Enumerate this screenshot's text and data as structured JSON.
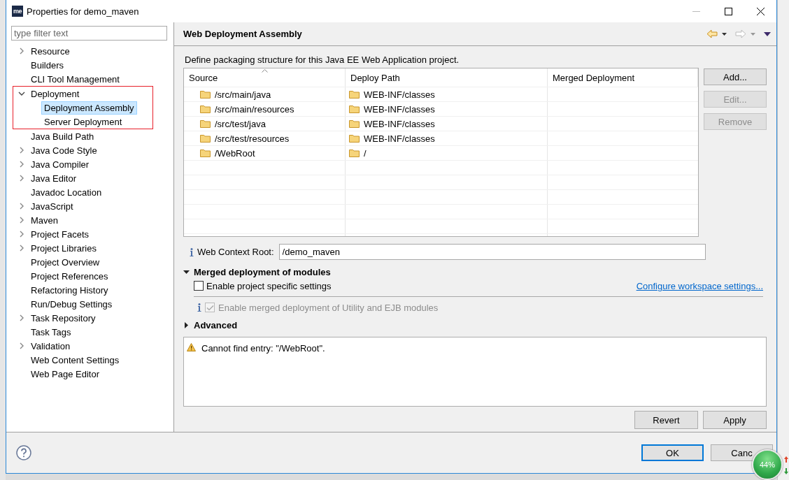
{
  "window": {
    "title": "Properties for demo_maven",
    "app_icon_text": "me"
  },
  "filter": {
    "placeholder": "type filter text"
  },
  "tree": [
    {
      "label": "Resource",
      "kind": "branch",
      "expanded": false,
      "selected": false
    },
    {
      "label": "Builders",
      "kind": "leaf",
      "selected": false
    },
    {
      "label": "CLI Tool Management",
      "kind": "leaf",
      "selected": false
    },
    {
      "label": "Deployment",
      "kind": "branch",
      "expanded": true,
      "selected": false,
      "marked": true,
      "children": [
        {
          "label": "Deployment Assembly",
          "kind": "leaf",
          "selected": true
        },
        {
          "label": "Server Deployment",
          "kind": "leaf",
          "selected": false
        }
      ]
    },
    {
      "label": "Java Build Path",
      "kind": "leaf",
      "selected": false
    },
    {
      "label": "Java Code Style",
      "kind": "branch",
      "expanded": false,
      "selected": false
    },
    {
      "label": "Java Compiler",
      "kind": "branch",
      "expanded": false,
      "selected": false
    },
    {
      "label": "Java Editor",
      "kind": "branch",
      "expanded": false,
      "selected": false
    },
    {
      "label": "Javadoc Location",
      "kind": "leaf",
      "selected": false
    },
    {
      "label": "JavaScript",
      "kind": "branch",
      "expanded": false,
      "selected": false
    },
    {
      "label": "Maven",
      "kind": "branch",
      "expanded": false,
      "selected": false
    },
    {
      "label": "Project Facets",
      "kind": "branch",
      "expanded": false,
      "selected": false
    },
    {
      "label": "Project Libraries",
      "kind": "branch",
      "expanded": false,
      "selected": false
    },
    {
      "label": "Project Overview",
      "kind": "leaf",
      "selected": false
    },
    {
      "label": "Project References",
      "kind": "leaf",
      "selected": false
    },
    {
      "label": "Refactoring History",
      "kind": "leaf",
      "selected": false
    },
    {
      "label": "Run/Debug Settings",
      "kind": "leaf",
      "selected": false
    },
    {
      "label": "Task Repository",
      "kind": "branch",
      "expanded": false,
      "selected": false
    },
    {
      "label": "Task Tags",
      "kind": "leaf",
      "selected": false
    },
    {
      "label": "Validation",
      "kind": "branch",
      "expanded": false,
      "selected": false
    },
    {
      "label": "Web Content Settings",
      "kind": "leaf",
      "selected": false
    },
    {
      "label": "Web Page Editor",
      "kind": "leaf",
      "selected": false
    }
  ],
  "page": {
    "title": "Web Deployment Assembly",
    "description": "Define packaging structure for this Java EE Web Application project.",
    "table": {
      "columns": [
        {
          "label": "Source",
          "sorted": true
        },
        {
          "label": "Deploy Path",
          "sorted": false
        },
        {
          "label": "Merged Deployment",
          "sorted": false
        }
      ],
      "rows": [
        {
          "source": "/src/main/java",
          "deploy_path": "WEB-INF/classes"
        },
        {
          "source": "/src/main/resources",
          "deploy_path": "WEB-INF/classes"
        },
        {
          "source": "/src/test/java",
          "deploy_path": "WEB-INF/classes"
        },
        {
          "source": "/src/test/resources",
          "deploy_path": "WEB-INF/classes"
        },
        {
          "source": "/WebRoot",
          "deploy_path": "/"
        }
      ]
    },
    "side_buttons": [
      {
        "label": "Add...",
        "disabled": false
      },
      {
        "label": "Edit...",
        "disabled": true
      },
      {
        "label": "Remove",
        "disabled": true
      }
    ],
    "context_root": {
      "label": "Web Context Root:",
      "value": "/demo_maven"
    },
    "merged_section": {
      "title": "Merged deployment of modules",
      "expanded": true,
      "project_specific": {
        "label": "Enable project specific settings",
        "checked": false
      },
      "link": "Configure workspace settings...",
      "merged_option": {
        "label": "Enable merged deployment of Utility and EJB modules",
        "checked": true,
        "disabled": true
      }
    },
    "advanced": {
      "title": "Advanced",
      "expanded": false
    },
    "message": {
      "text": "Cannot find entry: \"/WebRoot\".",
      "kind": "warning"
    },
    "actions": [
      {
        "label": "Revert"
      },
      {
        "label": "Apply"
      }
    ]
  },
  "footer_buttons": [
    {
      "label": "OK",
      "default": true
    },
    {
      "label": "Canc",
      "default": false
    }
  ],
  "overlay_widget": {
    "reading": "44%"
  }
}
